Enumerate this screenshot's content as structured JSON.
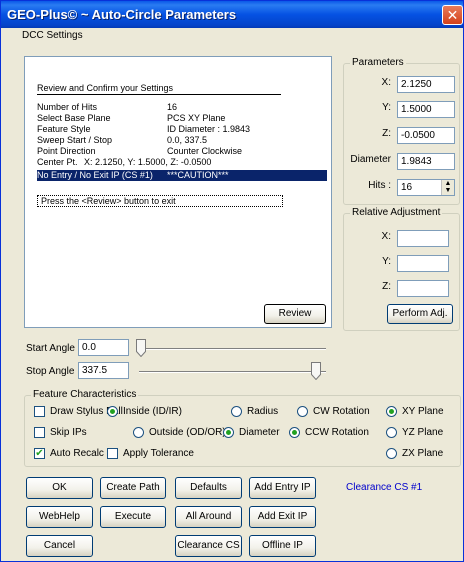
{
  "window": {
    "title": "GEO-Plus© ~ Auto-Circle Parameters",
    "close_glyph": "✕"
  },
  "menu": {
    "items": [
      {
        "label": "DCC Settings"
      }
    ]
  },
  "review": {
    "header": "Review and Confirm your Settings",
    "rows": [
      {
        "label": "Number of Hits",
        "value": "16"
      },
      {
        "label": "Select Base Plane",
        "value": "PCS XY Plane"
      },
      {
        "label": "Feature Style",
        "value": "ID  Diameter : 1.9843"
      },
      {
        "label": "Sweep Start / Stop",
        "value": "0.0, 337.5"
      },
      {
        "label": "Point Direction",
        "value": "Counter Clockwise"
      },
      {
        "label": "Center Pt.",
        "value": "X: 2.1250, Y: 1.5000, Z: -0.0500"
      }
    ],
    "highlight": {
      "label": "No Entry / No Exit IP (CS #1)",
      "value": "***CAUTION***"
    },
    "prompt": "Press the <Review> button to exit",
    "review_button": "Review"
  },
  "parameters": {
    "title": "Parameters",
    "x_label": "X:",
    "x_value": "2.1250",
    "y_label": "Y:",
    "y_value": "1.5000",
    "z_label": "Z:",
    "z_value": "-0.0500",
    "diameter_label": "Diameter",
    "diameter_value": "1.9843",
    "hits_label": "Hits :",
    "hits_value": "16",
    "spin_up": "▲",
    "spin_down": "▼"
  },
  "relative": {
    "title": "Relative Adjustment",
    "x_label": "X:",
    "x_value": "",
    "y_label": "Y:",
    "y_value": "",
    "z_label": "Z:",
    "z_value": "",
    "perform_button": "Perform Adj."
  },
  "angles": {
    "start_label": "Start Angle",
    "start_value": "0.0",
    "start_fraction": 0.0,
    "stop_label": "Stop Angle",
    "stop_value": "337.5",
    "stop_fraction": 0.9375
  },
  "features": {
    "title": "Feature Characteristics",
    "draw_stylus_ball": {
      "label": "Draw Stylus Ball",
      "checked": false
    },
    "skip_ips": {
      "label": "Skip IPs",
      "checked": false
    },
    "auto_recalc": {
      "label": "Auto Recalc",
      "checked": true
    },
    "inside": {
      "label": "Inside (ID/IR)",
      "selected": true
    },
    "outside": {
      "label": "Outside (OD/OR)",
      "selected": false
    },
    "apply_tolerance": {
      "label": "Apply Tolerance",
      "checked": false
    },
    "radius": {
      "label": "Radius",
      "selected": false
    },
    "diameter": {
      "label": "Diameter",
      "selected": true
    },
    "cw_rotation": {
      "label": "CW Rotation",
      "selected": false
    },
    "ccw_rotation": {
      "label": "CCW Rotation",
      "selected": true
    },
    "xy_plane": {
      "label": "XY Plane",
      "selected": true
    },
    "yz_plane": {
      "label": "YZ Plane",
      "selected": false
    },
    "zx_plane": {
      "label": "ZX Plane",
      "selected": false
    },
    "check_glyph": "✔"
  },
  "buttons": {
    "ok": "OK",
    "create_path": "Create Path",
    "defaults": "Defaults",
    "add_entry_ip": "Add Entry IP",
    "webhelp": "WebHelp",
    "execute": "Execute",
    "all_around": "All Around",
    "add_exit_ip": "Add Exit IP",
    "cancel": "Cancel",
    "clearance_cs": "Clearance CS",
    "offline_ip": "Offline IP"
  },
  "clearance_status": "Clearance CS #1"
}
